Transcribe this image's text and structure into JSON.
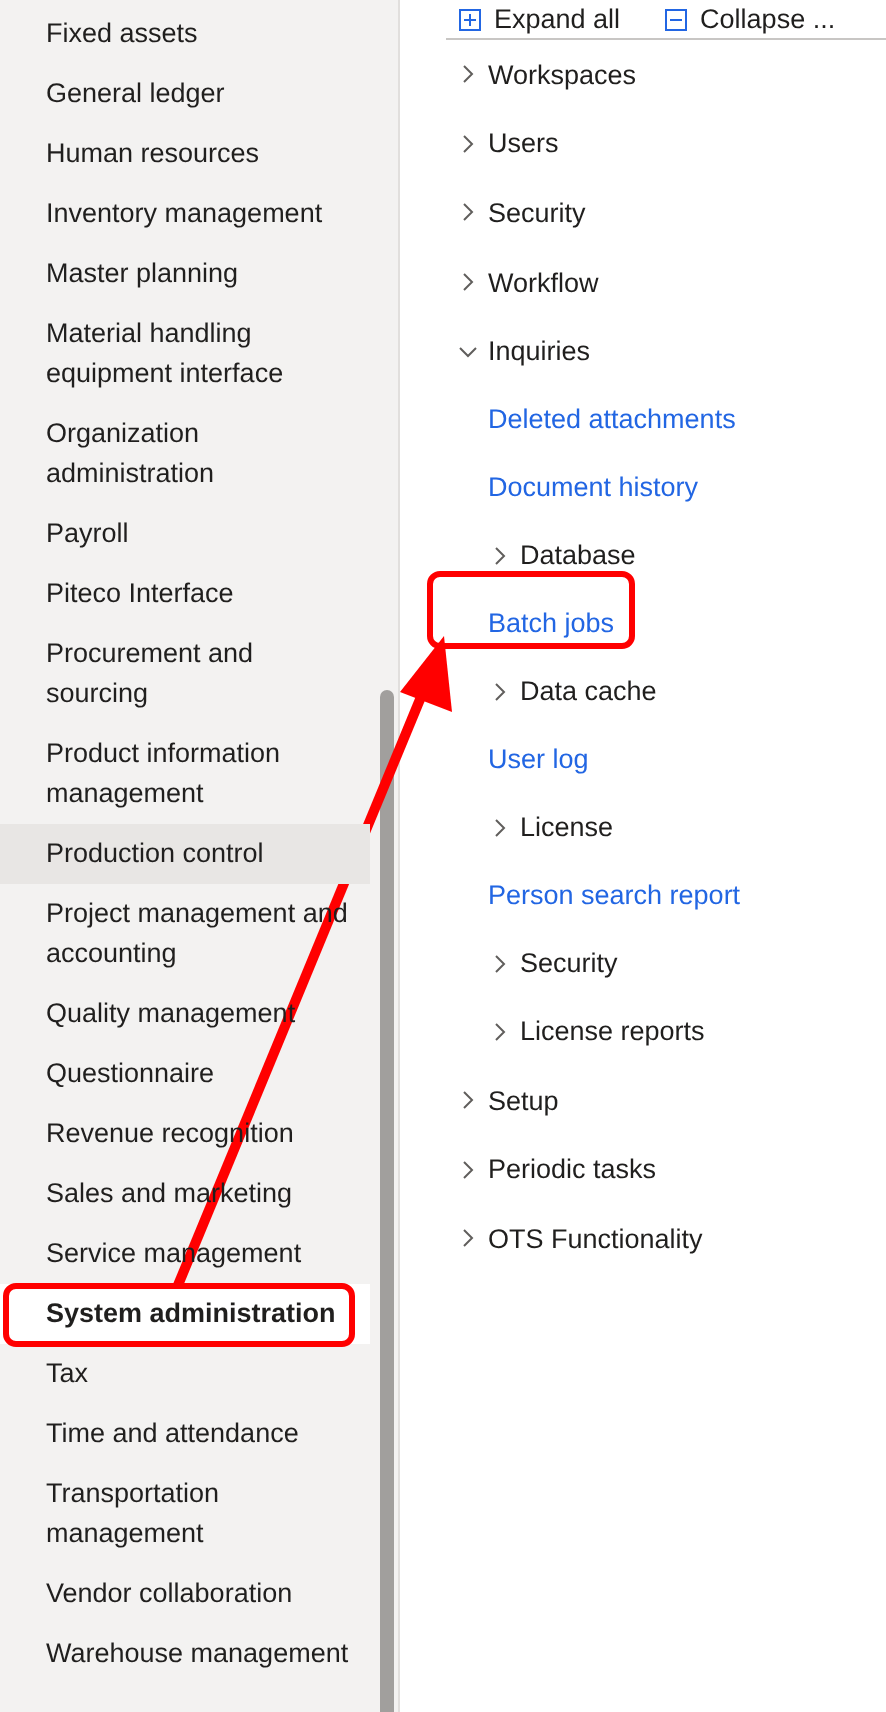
{
  "modules": [
    {
      "label": "Fixed assets",
      "selected": false,
      "hovered": false
    },
    {
      "label": "General ledger",
      "selected": false,
      "hovered": false
    },
    {
      "label": "Human resources",
      "selected": false,
      "hovered": false
    },
    {
      "label": "Inventory management",
      "selected": false,
      "hovered": false
    },
    {
      "label": "Master planning",
      "selected": false,
      "hovered": false
    },
    {
      "label": "Material handling equipment interface",
      "selected": false,
      "hovered": false
    },
    {
      "label": "Organization administration",
      "selected": false,
      "hovered": false
    },
    {
      "label": "Payroll",
      "selected": false,
      "hovered": false
    },
    {
      "label": "Piteco Interface",
      "selected": false,
      "hovered": false
    },
    {
      "label": "Procurement and sourcing",
      "selected": false,
      "hovered": false
    },
    {
      "label": "Product information management",
      "selected": false,
      "hovered": false
    },
    {
      "label": "Production control",
      "selected": false,
      "hovered": true
    },
    {
      "label": "Project management and accounting",
      "selected": false,
      "hovered": false
    },
    {
      "label": "Quality management",
      "selected": false,
      "hovered": false
    },
    {
      "label": "Questionnaire",
      "selected": false,
      "hovered": false
    },
    {
      "label": "Revenue recognition",
      "selected": false,
      "hovered": false
    },
    {
      "label": "Sales and marketing",
      "selected": false,
      "hovered": false
    },
    {
      "label": "Service management",
      "selected": false,
      "hovered": false
    },
    {
      "label": "System administration",
      "selected": true,
      "hovered": false
    },
    {
      "label": "Tax",
      "selected": false,
      "hovered": false
    },
    {
      "label": "Time and attendance",
      "selected": false,
      "hovered": false
    },
    {
      "label": "Transportation management",
      "selected": false,
      "hovered": false
    },
    {
      "label": "Vendor collaboration",
      "selected": false,
      "hovered": false
    },
    {
      "label": "Warehouse management",
      "selected": false,
      "hovered": false
    }
  ],
  "toolbar": [
    {
      "kind": "expand",
      "label": "Expand all"
    },
    {
      "kind": "collapse",
      "label": "Collapse ..."
    }
  ],
  "tree": [
    {
      "label": "Workspaces",
      "expanded": false
    },
    {
      "label": "Users",
      "expanded": false
    },
    {
      "label": "Security",
      "expanded": false
    },
    {
      "label": "Workflow",
      "expanded": false
    },
    {
      "label": "Inquiries",
      "expanded": true,
      "children": [
        {
          "kind": "link",
          "label": "Deleted attachments"
        },
        {
          "kind": "link",
          "label": "Document history"
        },
        {
          "kind": "group",
          "label": "Database",
          "expanded": false
        },
        {
          "kind": "link",
          "label": "Batch jobs"
        },
        {
          "kind": "group",
          "label": "Data cache",
          "expanded": false
        },
        {
          "kind": "link",
          "label": "User log"
        },
        {
          "kind": "group",
          "label": "License",
          "expanded": false
        },
        {
          "kind": "link",
          "label": "Person search report"
        },
        {
          "kind": "group",
          "label": "Security",
          "expanded": false
        },
        {
          "kind": "group",
          "label": "License reports",
          "expanded": false
        }
      ]
    },
    {
      "label": "Setup",
      "expanded": false
    },
    {
      "label": "Periodic tasks",
      "expanded": false
    },
    {
      "label": "OTS Functionality",
      "expanded": false
    }
  ]
}
